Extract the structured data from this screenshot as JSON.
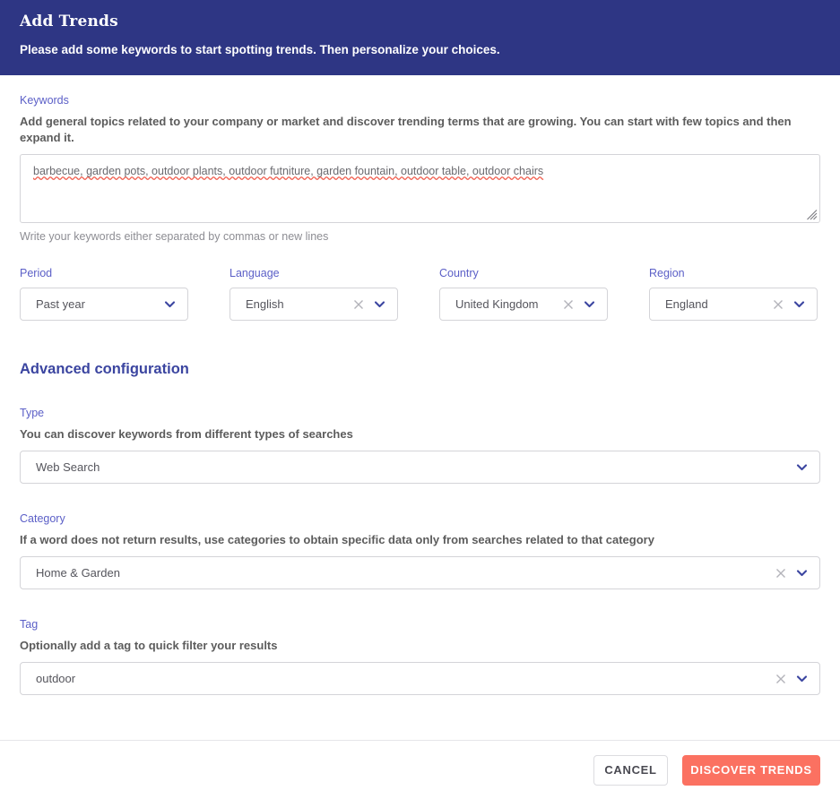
{
  "header": {
    "title": "Add Trends",
    "subtitle": "Please add some keywords to start spotting trends. Then personalize your choices."
  },
  "keywords": {
    "label": "Keywords",
    "description": "Add general topics related to your company or market and discover trending terms that are growing. You can start with few topics and then expand it.",
    "value": "barbecue, garden pots, outdoor plants, outdoor futniture, garden fountain, outdoor table, outdoor chairs",
    "placeholder": "",
    "hint": "Write your keywords either separated by commas or new lines",
    "resize_handle_icon": "resize-grip-icon"
  },
  "filters": [
    {
      "label": "Period",
      "value": "Past year",
      "clearable": false,
      "clear_icon": "close-icon",
      "chevron_icon": "chevron-down-icon",
      "name": "period"
    },
    {
      "label": "Language",
      "value": "English",
      "clearable": true,
      "clear_icon": "close-icon",
      "chevron_icon": "chevron-down-icon",
      "name": "language"
    },
    {
      "label": "Country",
      "value": "United Kingdom",
      "clearable": true,
      "clear_icon": "close-icon",
      "chevron_icon": "chevron-down-icon",
      "name": "country"
    },
    {
      "label": "Region",
      "value": "England",
      "clearable": true,
      "clear_icon": "close-icon",
      "chevron_icon": "chevron-down-icon",
      "name": "region"
    }
  ],
  "advanced": {
    "title": "Advanced configuration",
    "type": {
      "label": "Type",
      "description": "You can discover keywords from different types of searches",
      "value": "Web Search",
      "clearable": false
    },
    "category": {
      "label": "Category",
      "description": "If a word does not return results, use categories to obtain specific data only from searches related to that category",
      "value": "Home & Garden",
      "clearable": true
    },
    "tag": {
      "label": "Tag",
      "description": "Optionally add a tag to quick filter your results",
      "value": "outdoor",
      "clearable": true
    }
  },
  "footer": {
    "cancel_label": "CANCEL",
    "submit_label": "DISCOVER TRENDS"
  },
  "colors": {
    "header_bg": "#2e3684",
    "label": "#5b5fc7",
    "advanced_title": "#3b45a0",
    "primary_button": "#fb7161",
    "border": "#d4d4d8",
    "spellcheck_underline": "#f05a4a"
  }
}
